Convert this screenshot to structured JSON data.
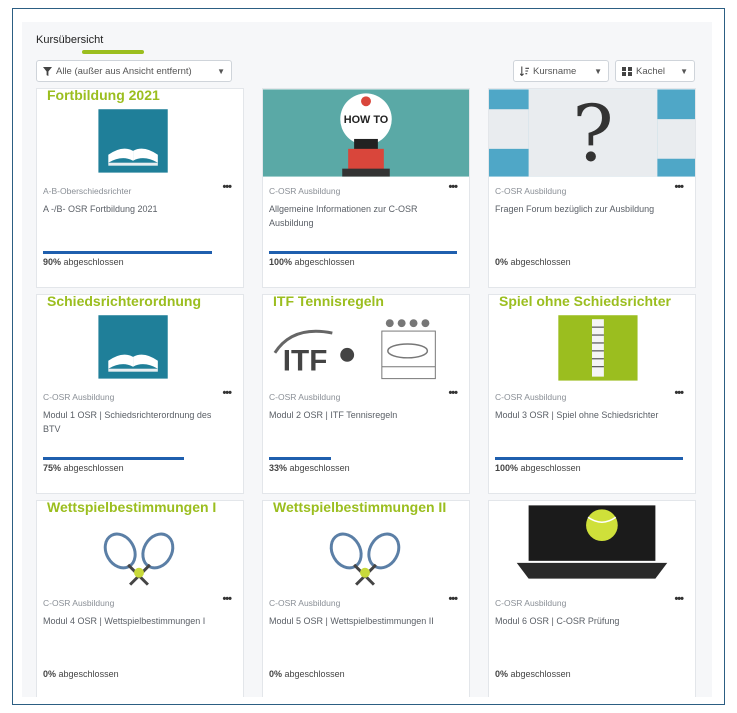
{
  "header": {
    "title": "Kursübersicht",
    "filter_label": "Alle (außer aus Ansicht entfernt)",
    "sort_label": "Kursname",
    "view_label": "Kachel"
  },
  "colors": {
    "accent": "#9bbe1f",
    "progress": "#1f5fae",
    "border": "#2c5e83"
  },
  "courses": [
    {
      "headline": "Fortbildung 2021",
      "image": "open-book",
      "category": "A-B-Oberschiedsrichter",
      "name": "A -/B- OSR Fortbildung 2021",
      "progress_value": "90%",
      "progress_text": "abgeschlossen",
      "progress": 0.9
    },
    {
      "headline": "",
      "image": "how-to",
      "category": "C-OSR Ausbildung",
      "name": "Allgemeine Informationen zur C-OSR Ausbildung",
      "progress_value": "100%",
      "progress_text": "abgeschlossen",
      "progress": 1.0
    },
    {
      "headline": "",
      "image": "puzzle-question",
      "category": "C-OSR Ausbildung",
      "name": "Fragen Forum bezüglich zur Ausbildung",
      "progress_value": "0%",
      "progress_text": "abgeschlossen",
      "progress": 0.0
    },
    {
      "headline": "Schiedsrichterordnung",
      "image": "open-book",
      "category": "C-OSR Ausbildung",
      "name": "Modul 1 OSR | Schiedsrichterordnung des BTV",
      "progress_value": "75%",
      "progress_text": "abgeschlossen",
      "progress": 0.75
    },
    {
      "headline": "ITF Tennisregeln",
      "image": "itf-logo",
      "category": "C-OSR Ausbildung",
      "name": "Modul 2 OSR | ITF Tennisregeln",
      "progress_value": "33%",
      "progress_text": "abgeschlossen",
      "progress": 0.33
    },
    {
      "headline": "Spiel ohne Schiedsrichter",
      "image": "umpire-chair",
      "category": "C-OSR Ausbildung",
      "name": "Modul 3 OSR | Spiel ohne Schiedsrichter",
      "progress_value": "100%",
      "progress_text": "abgeschlossen",
      "progress": 1.0
    },
    {
      "headline": "Wettspielbestimmungen I",
      "image": "rackets",
      "category": "C-OSR Ausbildung",
      "name": "Modul 4 OSR | Wettspielbestimmungen I",
      "progress_value": "0%",
      "progress_text": "abgeschlossen",
      "progress": 0.0
    },
    {
      "headline": "Wettspielbestimmungen II",
      "image": "rackets",
      "category": "C-OSR Ausbildung",
      "name": "Modul 5 OSR | Wettspielbestimmungen II",
      "progress_value": "0%",
      "progress_text": "abgeschlossen",
      "progress": 0.0
    },
    {
      "headline": "",
      "image": "laptop-ball",
      "category": "C-OSR Ausbildung",
      "name": "Modul 6 OSR | C-OSR Prüfung",
      "progress_value": "0%",
      "progress_text": "abgeschlossen",
      "progress": 0.0
    }
  ]
}
